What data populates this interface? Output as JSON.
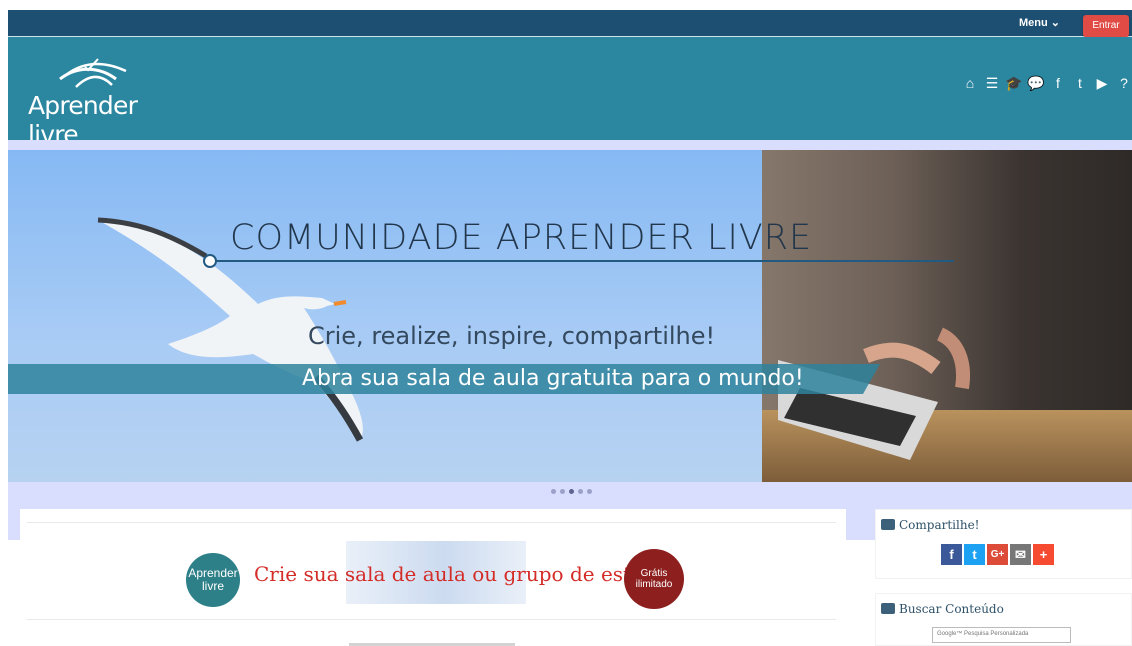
{
  "top_nav": {
    "menu_label": "Menu",
    "login_label": "Entrar"
  },
  "header": {
    "logo_text": "Aprender livre",
    "icons": [
      "home-icon",
      "list-icon",
      "graduation-cap-icon",
      "comments-icon",
      "facebook-icon",
      "twitter-icon",
      "youtube-icon",
      "help-icon"
    ]
  },
  "hero": {
    "title": "COMUNIDADE APRENDER LIVRE",
    "subtitle": "Crie, realize, inspire, compartilhe!",
    "band_text": "Abra sua sala de aula gratuita para o mundo!",
    "pagination": {
      "total": 5,
      "active_index": 2
    }
  },
  "main": {
    "promo_logo_text": "Aprender livre",
    "promo_text": "Crie sua sala de aula ou grupo de estudo",
    "promo_badge_top": "Grátis",
    "promo_badge_bottom": "ilimitado"
  },
  "sidebar": {
    "share_title": "Compartilhe!",
    "share_buttons": [
      "f",
      "t",
      "G+",
      "✉",
      "+"
    ],
    "search_title": "Buscar Conteúdo",
    "search_placeholder": "Google™ Pesquisa Personalizada"
  },
  "colors": {
    "top_bar": "#1d4f72",
    "header": "#2b86a0",
    "login": "#e14b45",
    "hero_band": "#2e829c"
  }
}
